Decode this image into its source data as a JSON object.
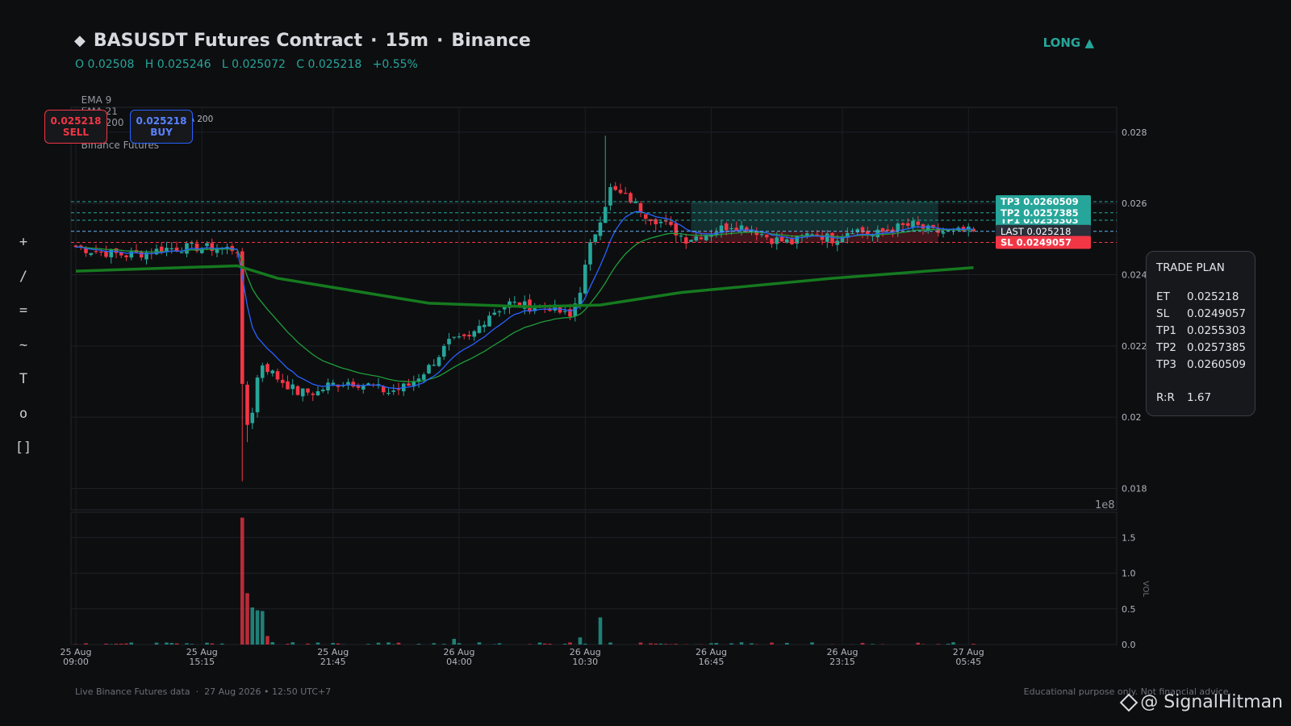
{
  "header": {
    "title": "BASUSDT Futures Contract",
    "sep": "·",
    "timeframe": "15m",
    "exchange": "Binance",
    "ohlc": "O 0.02508   H 0.025246   L 0.025072   C 0.025218   +0.55%",
    "indicators": [
      "EMA 9",
      "EMA 21",
      "EMA 200",
      "•",
      "Binance Futures"
    ],
    "signal": "LONG  ▲"
  },
  "toolbar": [
    {
      "icon": "crosshair-icon",
      "glyph": "+"
    },
    {
      "icon": "trendline-icon",
      "glyph": "/"
    },
    {
      "icon": "horizontal-line-icon",
      "glyph": "="
    },
    {
      "icon": "curve-icon",
      "glyph": "~"
    },
    {
      "icon": "text-tool-icon",
      "glyph": "T"
    },
    {
      "icon": "circle-tool-icon",
      "glyph": "o"
    },
    {
      "icon": "rectangle-tool-icon",
      "glyph": "[]"
    }
  ],
  "order": {
    "sell_price": "0.025218",
    "sell_label": "SELL",
    "buy_price": "0.025218",
    "buy_label": "BUY"
  },
  "trade_plan": {
    "title": "TRADE PLAN",
    "rows": [
      {
        "k": "ET",
        "v": "0.025218"
      },
      {
        "k": "SL",
        "v": "0.0249057"
      },
      {
        "k": "TP1",
        "v": "0.0255303"
      },
      {
        "k": "TP2",
        "v": "0.0257385"
      },
      {
        "k": "TP3",
        "v": "0.0260509"
      }
    ],
    "rr_label": "R:R",
    "rr_value": "1.67"
  },
  "footer": {
    "left": "Live Binance Futures data  ·  27 Aug 2026 • 12:50 UTC+7",
    "right": "Educational purpose only. Not financial advice.",
    "brand": "@ SignalHitman"
  },
  "colors": {
    "up": "#26a69a",
    "down": "#f23645",
    "ema9": "#2962ff",
    "ema21": "#1e9e3a",
    "ema200": "#157a1f",
    "last": "#64b5f6",
    "tp": "#26a69a",
    "sl": "#f23645"
  },
  "chart_data": {
    "type": "candlestick",
    "title": "BASUSDT Futures Contract · 15m · Binance",
    "price_ticks": [
      0.018,
      0.02,
      0.022,
      0.024,
      0.026,
      0.028
    ],
    "price_tick_labels": [
      "0.018",
      "0.02",
      "0.022",
      "0.024",
      "0.026",
      "0.028"
    ],
    "price_range": [
      0.0174,
      0.0287
    ],
    "volume_ticks": [
      0.0,
      0.5,
      1.0,
      1.5
    ],
    "volume_tick_labels": [
      "0.0",
      "0.5",
      "1.0",
      "1.5"
    ],
    "volume_range": [
      0,
      1.8
    ],
    "volume_exponent": "1e8",
    "volume_axis_label": "VOL",
    "time_labels": [
      [
        "25 Aug",
        "09:00"
      ],
      [
        "25 Aug",
        "15:15"
      ],
      [
        "25 Aug",
        "21:45"
      ],
      [
        "26 Aug",
        "04:00"
      ],
      [
        "26 Aug",
        "10:30"
      ],
      [
        "26 Aug",
        "16:45"
      ],
      [
        "26 Aug",
        "23:15"
      ],
      [
        "27 Aug",
        "05:45"
      ]
    ],
    "time_label_bars": [
      0,
      25,
      51,
      76,
      101,
      126,
      152,
      177
    ],
    "bar_count": 179,
    "legend": [
      "EMA 9",
      "EMA 21",
      "EMA 200"
    ],
    "anchors": [
      [
        0,
        0.02478
      ],
      [
        3,
        0.02468
      ],
      [
        6,
        0.02462
      ],
      [
        10,
        0.02455
      ],
      [
        14,
        0.02462
      ],
      [
        18,
        0.02474
      ],
      [
        24,
        0.02477
      ],
      [
        28,
        0.02475
      ],
      [
        32,
        0.02472
      ],
      [
        33,
        0.0208
      ],
      [
        34,
        0.0198
      ],
      [
        35,
        0.0202
      ],
      [
        36,
        0.0211
      ],
      [
        37,
        0.0215
      ],
      [
        40,
        0.0211
      ],
      [
        44,
        0.0207
      ],
      [
        48,
        0.0207
      ],
      [
        50,
        0.0209
      ],
      [
        54,
        0.021
      ],
      [
        58,
        0.0209
      ],
      [
        62,
        0.0207
      ],
      [
        66,
        0.0209
      ],
      [
        70,
        0.0214
      ],
      [
        74,
        0.0221
      ],
      [
        78,
        0.0222
      ],
      [
        82,
        0.0229
      ],
      [
        86,
        0.0232
      ],
      [
        90,
        0.0231
      ],
      [
        94,
        0.0231
      ],
      [
        98,
        0.0228
      ],
      [
        100,
        0.0236
      ],
      [
        102,
        0.0248
      ],
      [
        104,
        0.0256
      ],
      [
        106,
        0.0264
      ],
      [
        110,
        0.0261
      ],
      [
        113,
        0.0257
      ],
      [
        117,
        0.0254
      ],
      [
        121,
        0.025
      ],
      [
        126,
        0.0252
      ],
      [
        130,
        0.0254
      ],
      [
        134,
        0.0253
      ],
      [
        138,
        0.025
      ],
      [
        142,
        0.0249
      ],
      [
        146,
        0.0252
      ],
      [
        150,
        0.025
      ],
      [
        154,
        0.0253
      ],
      [
        158,
        0.0251
      ],
      [
        162,
        0.0253
      ],
      [
        166,
        0.0254
      ],
      [
        170,
        0.0252
      ],
      [
        174,
        0.0252
      ],
      [
        178,
        0.025218
      ]
    ],
    "ema200_points": [
      [
        0,
        0.0241
      ],
      [
        32,
        0.02425
      ],
      [
        40,
        0.0239
      ],
      [
        70,
        0.0232
      ],
      [
        90,
        0.0231
      ],
      [
        104,
        0.02315
      ],
      [
        120,
        0.0235
      ],
      [
        150,
        0.0239
      ],
      [
        178,
        0.0242
      ]
    ],
    "volume_spikes": [
      [
        33,
        1.78
      ],
      [
        34,
        0.72
      ],
      [
        35,
        0.52
      ],
      [
        36,
        0.48
      ],
      [
        37,
        0.47
      ],
      [
        38,
        0.12
      ],
      [
        104,
        0.38
      ],
      [
        75,
        0.08
      ],
      [
        100,
        0.1
      ]
    ],
    "levels": {
      "tp3": {
        "price": 0.0260509,
        "label": "TP3  0.0260509"
      },
      "tp2": {
        "price": 0.0257385,
        "label": "TP2  0.0257385"
      },
      "tp1": {
        "price": 0.0255303,
        "label": "TP1  0.0255303"
      },
      "last": {
        "price": 0.025218,
        "label": "LAST  0.025218"
      },
      "sl": {
        "price": 0.0249057,
        "label": "SL  0.0249057"
      }
    },
    "zone_bars": [
      122,
      171
    ]
  }
}
